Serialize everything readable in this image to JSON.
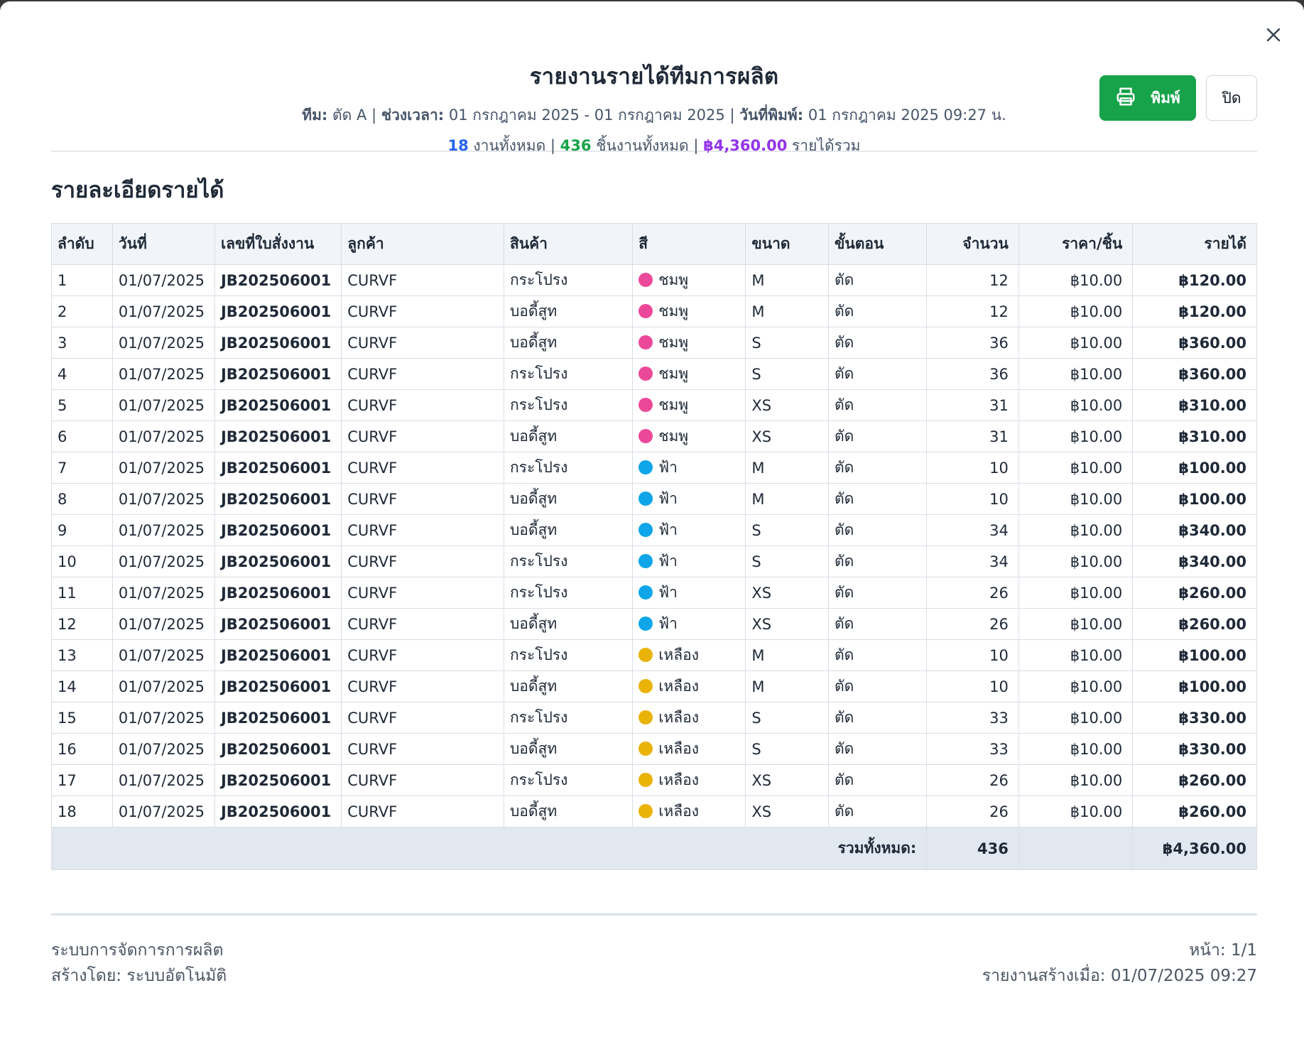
{
  "header": {
    "title": "รายงานรายได้ทีมการผลิต",
    "team_label": "ทีม:",
    "team_value": "ตัด A",
    "period_label": "ช่วงเวลา:",
    "period_value": "01 กรกฎาคม 2025 - 01 กรกฎาคม 2025",
    "printed_label": "วันที่พิมพ์:",
    "printed_value": "01 กรกฎาคม 2025 09:27 น.",
    "sep": "|",
    "total_jobs": "18",
    "total_jobs_label": "งานทั้งหมด",
    "total_pieces": "436",
    "total_pieces_label": "ชิ้นงานทั้งหมด",
    "total_income": "฿4,360.00",
    "total_income_label": "รายได้รวม"
  },
  "actions": {
    "print_label": "พิมพ์",
    "close_label": "ปิด"
  },
  "section_title": "รายละเอียดรายได้",
  "columns": [
    "ลำดับ",
    "วันที่",
    "เลขที่ใบสั่งงาน",
    "ลูกค้า",
    "สินค้า",
    "สี",
    "ขนาด",
    "ขั้นตอน",
    "จำนวน",
    "ราคา/ชิ้น",
    "รายได้"
  ],
  "color_map": {
    "ชมพู": "#ec4899",
    "ฟ้า": "#0ea5e9",
    "เหลือง": "#eab308"
  },
  "rows": [
    [
      "1",
      "01/07/2025",
      "JB202506001",
      "CURVF",
      "กระโปรง",
      "ชมพู",
      "M",
      "ตัด",
      "12",
      "฿10.00",
      "฿120.00"
    ],
    [
      "2",
      "01/07/2025",
      "JB202506001",
      "CURVF",
      "บอดี้สูท",
      "ชมพู",
      "M",
      "ตัด",
      "12",
      "฿10.00",
      "฿120.00"
    ],
    [
      "3",
      "01/07/2025",
      "JB202506001",
      "CURVF",
      "บอดี้สูท",
      "ชมพู",
      "S",
      "ตัด",
      "36",
      "฿10.00",
      "฿360.00"
    ],
    [
      "4",
      "01/07/2025",
      "JB202506001",
      "CURVF",
      "กระโปรง",
      "ชมพู",
      "S",
      "ตัด",
      "36",
      "฿10.00",
      "฿360.00"
    ],
    [
      "5",
      "01/07/2025",
      "JB202506001",
      "CURVF",
      "กระโปรง",
      "ชมพู",
      "XS",
      "ตัด",
      "31",
      "฿10.00",
      "฿310.00"
    ],
    [
      "6",
      "01/07/2025",
      "JB202506001",
      "CURVF",
      "บอดี้สูท",
      "ชมพู",
      "XS",
      "ตัด",
      "31",
      "฿10.00",
      "฿310.00"
    ],
    [
      "7",
      "01/07/2025",
      "JB202506001",
      "CURVF",
      "กระโปรง",
      "ฟ้า",
      "M",
      "ตัด",
      "10",
      "฿10.00",
      "฿100.00"
    ],
    [
      "8",
      "01/07/2025",
      "JB202506001",
      "CURVF",
      "บอดี้สูท",
      "ฟ้า",
      "M",
      "ตัด",
      "10",
      "฿10.00",
      "฿100.00"
    ],
    [
      "9",
      "01/07/2025",
      "JB202506001",
      "CURVF",
      "บอดี้สูท",
      "ฟ้า",
      "S",
      "ตัด",
      "34",
      "฿10.00",
      "฿340.00"
    ],
    [
      "10",
      "01/07/2025",
      "JB202506001",
      "CURVF",
      "กระโปรง",
      "ฟ้า",
      "S",
      "ตัด",
      "34",
      "฿10.00",
      "฿340.00"
    ],
    [
      "11",
      "01/07/2025",
      "JB202506001",
      "CURVF",
      "กระโปรง",
      "ฟ้า",
      "XS",
      "ตัด",
      "26",
      "฿10.00",
      "฿260.00"
    ],
    [
      "12",
      "01/07/2025",
      "JB202506001",
      "CURVF",
      "บอดี้สูท",
      "ฟ้า",
      "XS",
      "ตัด",
      "26",
      "฿10.00",
      "฿260.00"
    ],
    [
      "13",
      "01/07/2025",
      "JB202506001",
      "CURVF",
      "กระโปรง",
      "เหลือง",
      "M",
      "ตัด",
      "10",
      "฿10.00",
      "฿100.00"
    ],
    [
      "14",
      "01/07/2025",
      "JB202506001",
      "CURVF",
      "บอดี้สูท",
      "เหลือง",
      "M",
      "ตัด",
      "10",
      "฿10.00",
      "฿100.00"
    ],
    [
      "15",
      "01/07/2025",
      "JB202506001",
      "CURVF",
      "กระโปรง",
      "เหลือง",
      "S",
      "ตัด",
      "33",
      "฿10.00",
      "฿330.00"
    ],
    [
      "16",
      "01/07/2025",
      "JB202506001",
      "CURVF",
      "บอดี้สูท",
      "เหลือง",
      "S",
      "ตัด",
      "33",
      "฿10.00",
      "฿330.00"
    ],
    [
      "17",
      "01/07/2025",
      "JB202506001",
      "CURVF",
      "กระโปรง",
      "เหลือง",
      "XS",
      "ตัด",
      "26",
      "฿10.00",
      "฿260.00"
    ],
    [
      "18",
      "01/07/2025",
      "JB202506001",
      "CURVF",
      "บอดี้สูท",
      "เหลือง",
      "XS",
      "ตัด",
      "26",
      "฿10.00",
      "฿260.00"
    ]
  ],
  "totals": {
    "label": "รวมทั้งหมด:",
    "quantity": "436",
    "income": "฿4,360.00"
  },
  "footer": {
    "system_name": "ระบบการจัดการการผลิต",
    "created_by": "สร้างโดย: ระบบอัตโนมัติ",
    "page": "หน้า: 1/1",
    "generated_at": "รายงานสร้างเมื่อ: 01/07/2025 09:27"
  }
}
